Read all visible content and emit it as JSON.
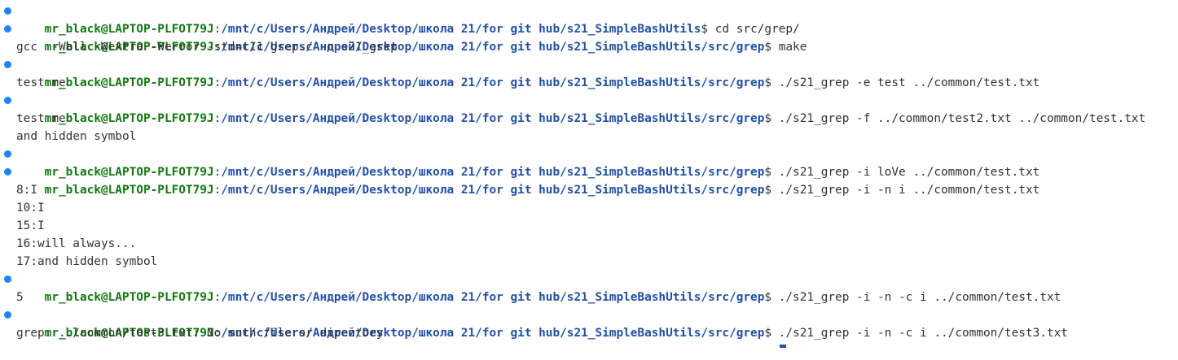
{
  "colors": {
    "background": "#ffffff",
    "user": "#0e7a0d",
    "path": "#1f4fb0",
    "text": "#333333",
    "prompt_dot": "#1a85ff"
  },
  "prompt": {
    "user_host": "mr_black@LAPTOP-PLFOT79J",
    "separator": ":",
    "path_root": "/mnt/c/Users/Андрей/Desktop/школа 21/for git hub/s21_SimpleBashUtils",
    "path_grep": "/mnt/c/Users/Андрей/Desktop/школа 21/for git hub/s21_SimpleBashUtils/src/grep",
    "symbol": "$"
  },
  "lines": [
    {
      "type": "prompt",
      "cmd": " cd src/grep/"
    },
    {
      "type": "prompt",
      "cmd": " make"
    },
    {
      "type": "output",
      "text": "gcc  -Wall -Wextra -Werror -std=c11 grep.c -o s21_grep"
    },
    {
      "type": "prompt",
      "cmd": " ./s21_grep -e test ../common/test.txt"
    },
    {
      "type": "output",
      "text": "test me"
    },
    {
      "type": "prompt",
      "cmd": " ./s21_grep -f ../common/test2.txt ../common/test.txt"
    },
    {
      "type": "output",
      "text": "test me"
    },
    {
      "type": "output",
      "text": "and hidden symbol"
    },
    {
      "type": "prompt",
      "cmd": " ./s21_grep -i loVe ../common/test.txt"
    },
    {
      "type": "prompt",
      "cmd": " ./s21_grep -i -n i ../common/test.txt"
    },
    {
      "type": "output",
      "text": "8:I"
    },
    {
      "type": "output",
      "text": "10:I"
    },
    {
      "type": "output",
      "text": "15:I"
    },
    {
      "type": "output",
      "text": "16:will always..."
    },
    {
      "type": "output",
      "text": "17:and hidden symbol"
    },
    {
      "type": "prompt",
      "cmd": " ./s21_grep -i -n -c i ../common/test.txt"
    },
    {
      "type": "output",
      "text": "5"
    },
    {
      "type": "prompt",
      "cmd": " ./s21_grep -i -n -c i ../common/test3.txt"
    },
    {
      "type": "output",
      "text": "grep: ../common/test3.txt: No such file or directory"
    }
  ]
}
